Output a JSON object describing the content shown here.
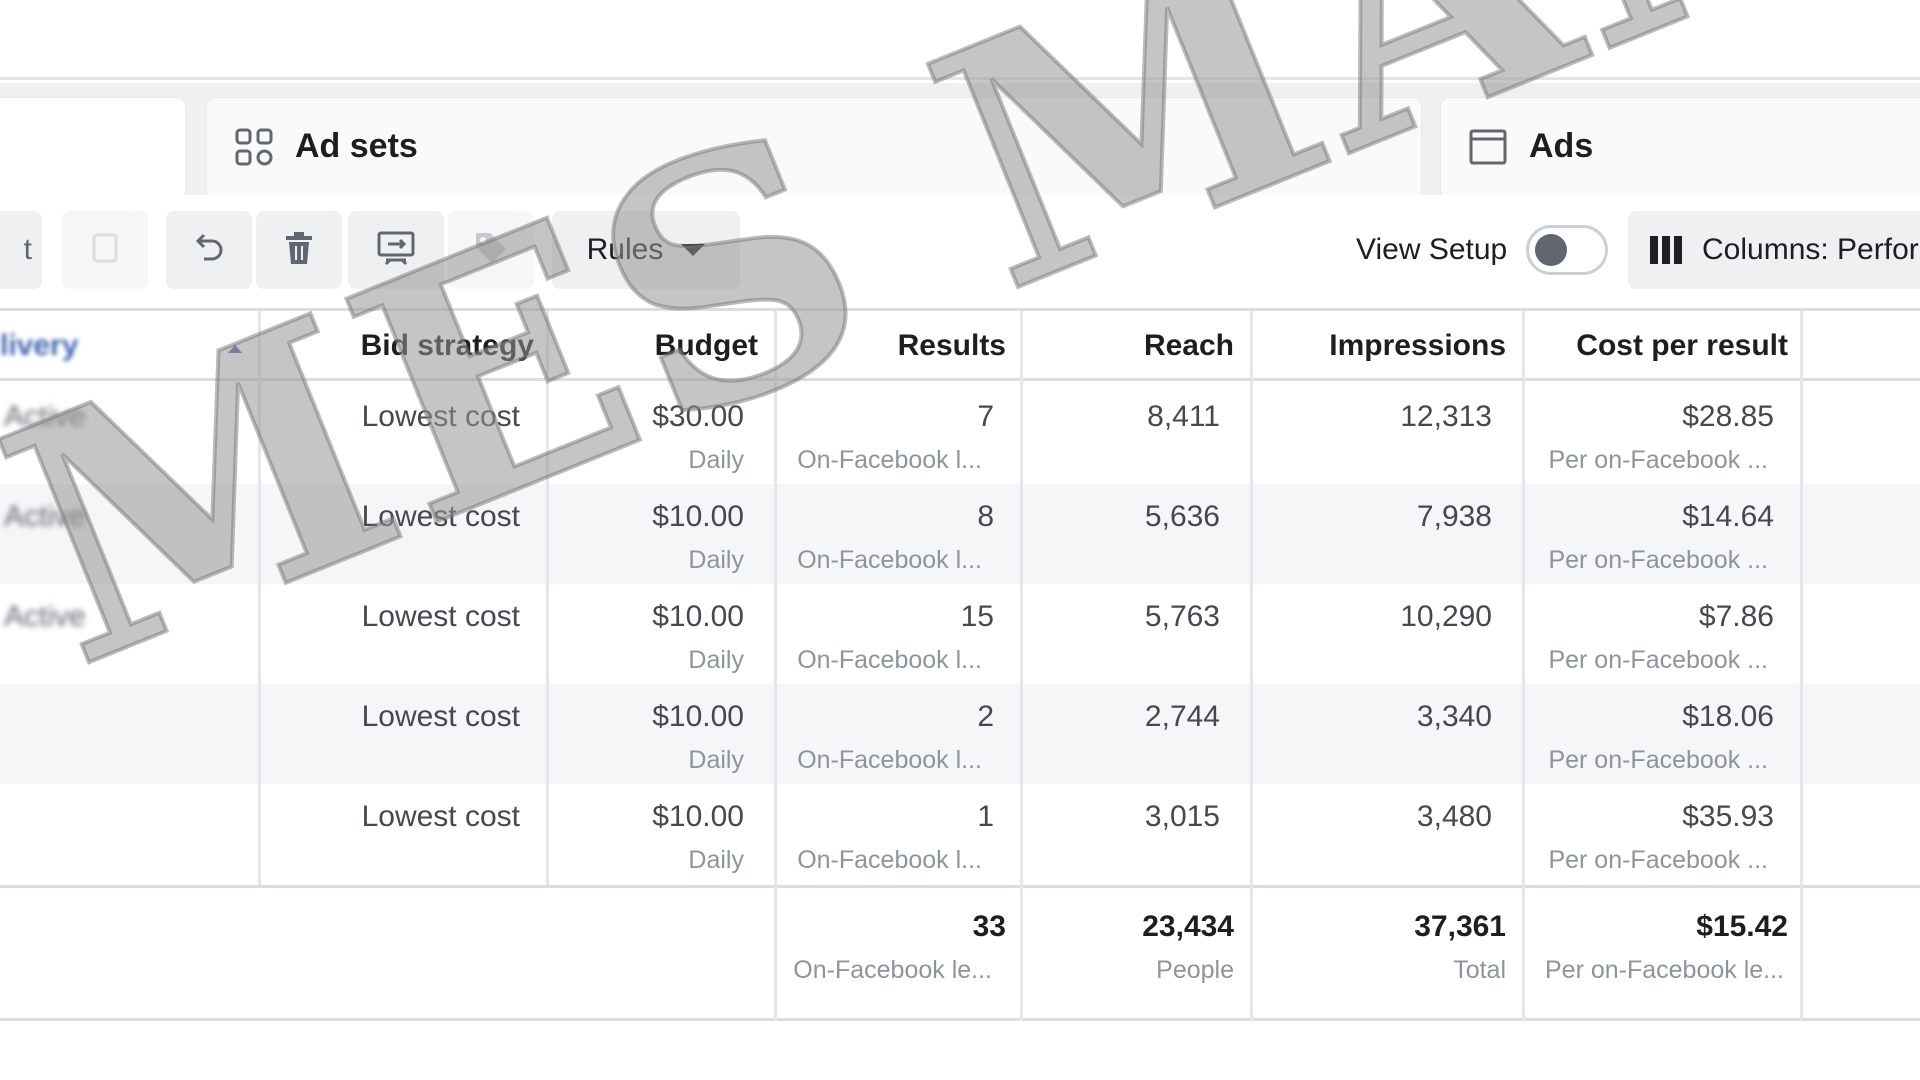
{
  "tabs": [
    {
      "label": "",
      "icon": "campaigns-folder-icon",
      "active": true
    },
    {
      "label": "Ad sets",
      "icon": "grid-icon"
    },
    {
      "label": "Ads",
      "icon": "ad-window-icon"
    }
  ],
  "toolbar": {
    "edit_partial": "t",
    "rules_label": "Rules",
    "view_setup_label": "View Setup",
    "view_setup_on": false,
    "columns_label": "Columns: Perfor",
    "icons": [
      "duplicate-icon",
      "undo-icon",
      "delete-icon",
      "ab-test-icon",
      "tag-icon"
    ]
  },
  "table": {
    "headers": {
      "delivery": "livery",
      "bid_strategy": "Bid strategy",
      "budget": "Budget",
      "results": "Results",
      "reach": "Reach",
      "impressions": "Impressions",
      "cost_per_result": "Cost per result"
    },
    "rows": [
      {
        "delivery": "Active",
        "bid": "Lowest cost",
        "budget": "$30.00",
        "budget_sub": "Daily",
        "results": "7",
        "results_sub": "On-Facebook l...",
        "reach": "8,411",
        "impressions": "12,313",
        "cpr": "$28.85",
        "cpr_sub": "Per on-Facebook ..."
      },
      {
        "delivery": "Active",
        "bid": "Lowest cost",
        "budget": "$10.00",
        "budget_sub": "Daily",
        "results": "8",
        "results_sub": "On-Facebook l...",
        "reach": "5,636",
        "impressions": "7,938",
        "cpr": "$14.64",
        "cpr_sub": "Per on-Facebook ..."
      },
      {
        "delivery": "Active",
        "bid": "Lowest cost",
        "budget": "$10.00",
        "budget_sub": "Daily",
        "results": "15",
        "results_sub": "On-Facebook l...",
        "reach": "5,763",
        "impressions": "10,290",
        "cpr": "$7.86",
        "cpr_sub": "Per on-Facebook ..."
      },
      {
        "delivery": "",
        "bid": "Lowest cost",
        "budget": "$10.00",
        "budget_sub": "Daily",
        "results": "2",
        "results_sub": "On-Facebook l...",
        "reach": "2,744",
        "impressions": "3,340",
        "cpr": "$18.06",
        "cpr_sub": "Per on-Facebook ..."
      },
      {
        "delivery": "",
        "bid": "Lowest cost",
        "budget": "$10.00",
        "budget_sub": "Daily",
        "results": "1",
        "results_sub": "On-Facebook l...",
        "reach": "3,015",
        "impressions": "3,480",
        "cpr": "$35.93",
        "cpr_sub": "Per on-Facebook ..."
      }
    ],
    "totals": {
      "results": "33",
      "results_sub": "On-Facebook le...",
      "reach": "23,434",
      "reach_sub": "People",
      "impressions": "37,361",
      "impressions_sub": "Total",
      "cpr": "$15.42",
      "cpr_sub": "Per on-Facebook le..."
    }
  },
  "watermark": "MES MANLEY"
}
